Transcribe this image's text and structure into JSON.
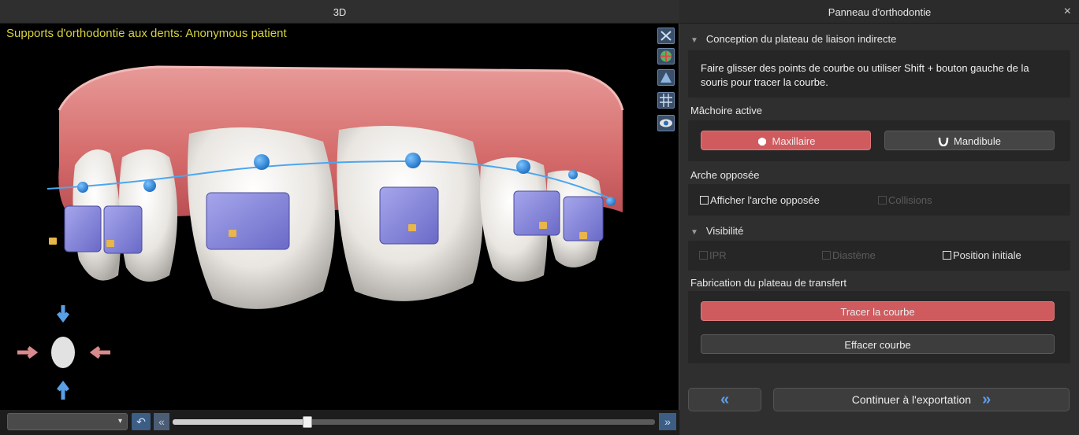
{
  "view3d": {
    "title": "3D",
    "caption": "Supports d'orthodontie aux dents: Anonymous patient",
    "tools": [
      "cut-icon",
      "orientation-icon",
      "mesh-icon",
      "grid-icon",
      "eye-icon"
    ],
    "orientation_widget": [
      "arrow-up-icon",
      "arrow-down-icon",
      "arrow-left-icon",
      "arrow-right-icon",
      "head-icon"
    ],
    "view_select": {
      "value": ""
    },
    "timeline": {
      "position": 0.28
    }
  },
  "panel": {
    "title": "Panneau d'orthodontie",
    "close": "×",
    "section_conception": "Conception du plateau de liaison indirecte",
    "hint": "Faire glisser des points de courbe ou utiliser Shift + bouton gauche de la souris pour tracer la courbe.",
    "jaw": {
      "label": "Mâchoire active",
      "maxillaire": "Maxillaire",
      "mandibule": "Mandibule"
    },
    "opposing": {
      "label": "Arche opposée",
      "show": "Afficher l'arche opposée",
      "collisions": "Collisions"
    },
    "visibility": {
      "label": "Visibilité",
      "ipr": "IPR",
      "diasteme": "Diastème",
      "initial": "Position initiale"
    },
    "fabrication": {
      "label": "Fabrication du plateau de transfert",
      "trace": "Tracer la courbe",
      "erase": "Effacer courbe"
    },
    "nav": {
      "back": "«",
      "continue": "Continuer à l'exportation",
      "continue_arrow": "»"
    }
  },
  "colors": {
    "accent_red": "#cf5b5f",
    "accent_blue": "#5f9ee8",
    "caption_yellow": "#d7d33e"
  }
}
